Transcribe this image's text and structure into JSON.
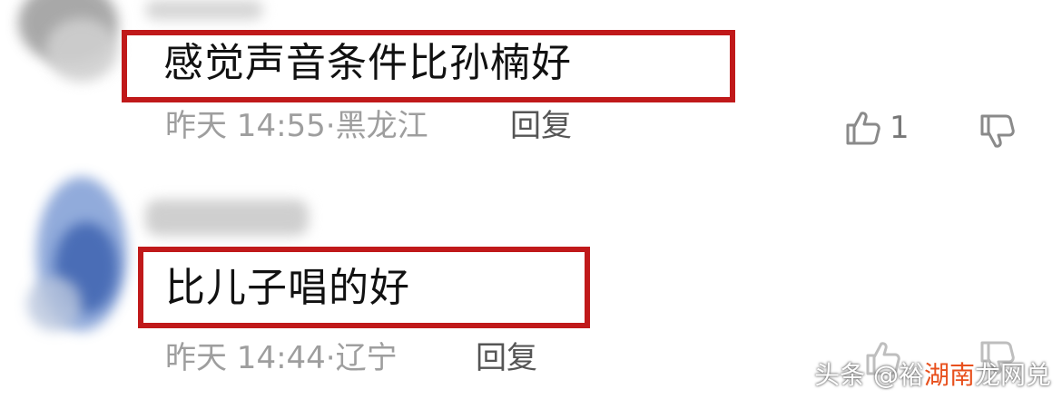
{
  "comments": [
    {
      "text": "感觉声音条件比孙楠好",
      "time": "昨天 14:55",
      "location": "黑龙江",
      "reply_label": "回复",
      "like_count": "1"
    },
    {
      "text": "比儿子唱的好",
      "time": "昨天 14:44",
      "location": "辽宁",
      "reply_label": "回复",
      "like_count": ""
    }
  ],
  "separator": "·",
  "watermark": {
    "prefix": "头条 @裕",
    "highlight": "湖南",
    "suffix": "龙网兑"
  },
  "colors": {
    "highlight_box": "#c0191a",
    "meta_text": "#9e9e9e",
    "body_text": "#111111"
  }
}
